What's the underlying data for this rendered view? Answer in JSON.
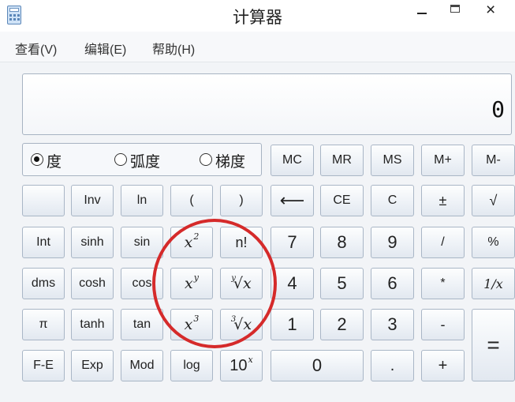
{
  "window": {
    "title": "计算器",
    "controls": {
      "minimize": "–",
      "close": "×"
    }
  },
  "menu": [
    {
      "label": "查看(V)"
    },
    {
      "label": "编辑(E)"
    },
    {
      "label": "帮助(H)"
    }
  ],
  "display": {
    "value": "0"
  },
  "angle_modes": [
    {
      "label": "度",
      "selected": true
    },
    {
      "label": "弧度",
      "selected": false
    },
    {
      "label": "梯度",
      "selected": false
    }
  ],
  "keys": {
    "mc": "MC",
    "mr": "MR",
    "ms": "MS",
    "mplus": "M+",
    "mminus": "M-",
    "inv": "Inv",
    "ln": "ln",
    "lparen": "(",
    "rparen": ")",
    "backspace": "⟵",
    "ce": "CE",
    "c": "C",
    "plusminus": "±",
    "sqrt": "√",
    "int": "Int",
    "sinh": "sinh",
    "sin": "sin",
    "x2_base": "x",
    "x2_exp": "2",
    "factorial": "n!",
    "seven": "7",
    "eight": "8",
    "nine": "9",
    "divide": "/",
    "percent": "%",
    "dms": "dms",
    "cosh": "cosh",
    "cos": "cos",
    "xy_base": "x",
    "xy_exp": "y",
    "yroot_index": "y",
    "yroot_body": "√x",
    "four": "4",
    "five": "5",
    "six": "6",
    "multiply": "*",
    "reciprocal": "1/x",
    "pi": "π",
    "tanh": "tanh",
    "tan": "tan",
    "x3_base": "x",
    "x3_exp": "3",
    "cuberoot_index": "3",
    "cuberoot_body": "√x",
    "one": "1",
    "two": "2",
    "three": "3",
    "minus": "-",
    "equals": "=",
    "fe": "F-E",
    "exp": "Exp",
    "mod": "Mod",
    "log": "log",
    "tenx_base": "10",
    "tenx_exp": "x",
    "zero": "0",
    "decimal": ".",
    "plus": "+"
  },
  "colors": {
    "annotation_circle": "#d52a2a"
  }
}
